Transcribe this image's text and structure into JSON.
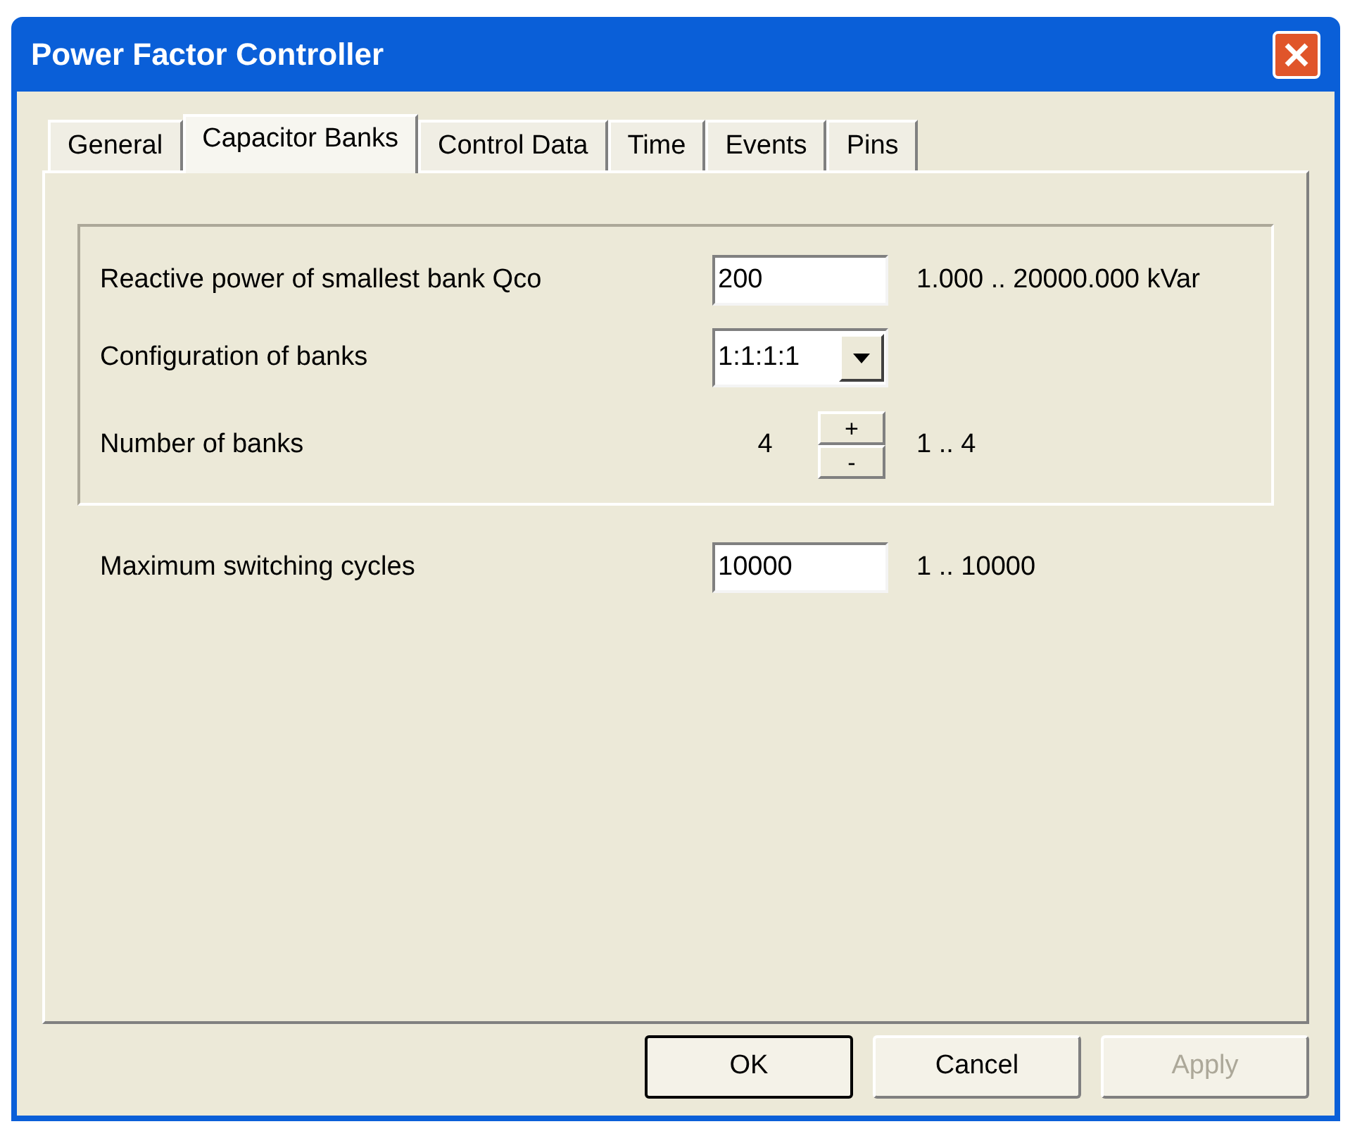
{
  "window": {
    "title": "Power Factor Controller"
  },
  "tabs": [
    {
      "label": "General",
      "selected": false
    },
    {
      "label": "Capacitor Banks",
      "selected": true
    },
    {
      "label": "Control Data",
      "selected": false
    },
    {
      "label": "Time",
      "selected": false
    },
    {
      "label": "Events",
      "selected": false
    },
    {
      "label": "Pins",
      "selected": false
    }
  ],
  "group": [
    {
      "kind": "text",
      "label": "Reactive power of smallest bank Qco",
      "value": "200",
      "range": "1.000 .. 20000.000 kVar"
    },
    {
      "kind": "combo",
      "label": "Configuration of banks",
      "value": "1:1:1:1"
    },
    {
      "kind": "spinner",
      "label": "Number of banks",
      "value": "4",
      "up": "+",
      "down": "-",
      "range": "1 .. 4"
    }
  ],
  "rows": [
    {
      "kind": "text",
      "label": "Maximum switching cycles",
      "value": "10000",
      "range": "1 .. 10000"
    }
  ],
  "buttons": [
    {
      "label": "OK",
      "default": true,
      "disabled": false
    },
    {
      "label": "Cancel",
      "default": false,
      "disabled": false
    },
    {
      "label": "Apply",
      "default": false,
      "disabled": true
    }
  ]
}
